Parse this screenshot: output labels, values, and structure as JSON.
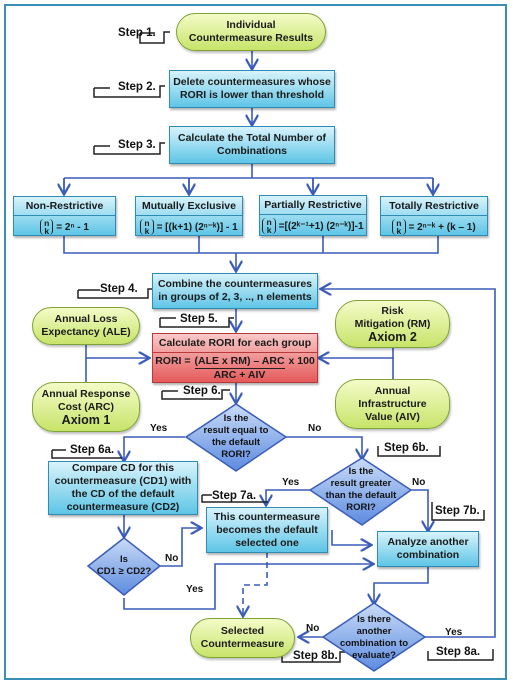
{
  "steps": {
    "s1": "Step 1.",
    "s2": "Step 2.",
    "s3": "Step 3.",
    "s4": "Step 4.",
    "s5": "Step 5.",
    "s6": "Step 6.",
    "s6a": "Step 6a.",
    "s6b": "Step 6b.",
    "s7a": "Step 7a.",
    "s7b": "Step 7b.",
    "s8a": "Step 8a.",
    "s8b": "Step 8b."
  },
  "nodes": {
    "start": [
      "Individual",
      "Countermeasure Results"
    ],
    "delete": [
      "Delete countermeasures whose",
      "RORI is lower than threshold"
    ],
    "calc_total": [
      "Calculate the Total Number of",
      "Combinations"
    ],
    "combine": [
      "Combine the countermeasures",
      "in groups of 2, 3, .., n elements"
    ],
    "rori_title": "Calculate RORI for each group",
    "rori_lhs": "RORI  =",
    "rori_num": "(ALE x RM) – ARC",
    "rori_mult": "x  100",
    "rori_den": "ARC + AIV",
    "ale": [
      "Annual Loss",
      "Expectancy (ALE)"
    ],
    "arc": [
      "Annual Response",
      "Cost (ARC)"
    ],
    "axiom1": "Axiom 1",
    "rm": [
      "Risk",
      "Mitigation (RM)"
    ],
    "axiom2": "Axiom 2",
    "aiv": [
      "Annual",
      "Infrastructure",
      "Value (AIV)"
    ],
    "compare": [
      "Compare CD for this",
      "countermeasure (CD1) with",
      "the CD of the default",
      "countermeasure (CD2)"
    ],
    "becomes": [
      "This countermeasure",
      "becomes the default",
      "selected one"
    ],
    "analyze": [
      "Analyze another",
      "combination"
    ],
    "selected": [
      "Selected",
      "Countermeasure"
    ]
  },
  "categories": [
    {
      "title": "Non-Restrictive",
      "formula": "= 2ⁿ - 1"
    },
    {
      "title": "Mutually Exclusive",
      "formula": "= [(k+1) (2ⁿ⁻ᵏ)] - 1"
    },
    {
      "title": "Partially Restrictive",
      "formula": "=[(2ᵏ⁻¹+1) (2ⁿ⁻ᵏ)]-1"
    },
    {
      "title": "Totally Restrictive",
      "formula": "= 2ⁿ⁻ᵏ  + (k – 1)"
    }
  ],
  "binom": {
    "top": "n",
    "bottom": "k"
  },
  "decisions": {
    "equal": [
      "Is the",
      "result equal to",
      "the default",
      "RORI?"
    ],
    "greater": [
      "Is the",
      "result greater",
      "than the default",
      "RORI?"
    ],
    "cd": [
      "Is",
      "CD1 ≥ CD2?"
    ],
    "another": [
      "Is there",
      "another",
      "combination to",
      "evaluate?"
    ]
  },
  "labels": {
    "yes": "Yes",
    "no": "No"
  }
}
